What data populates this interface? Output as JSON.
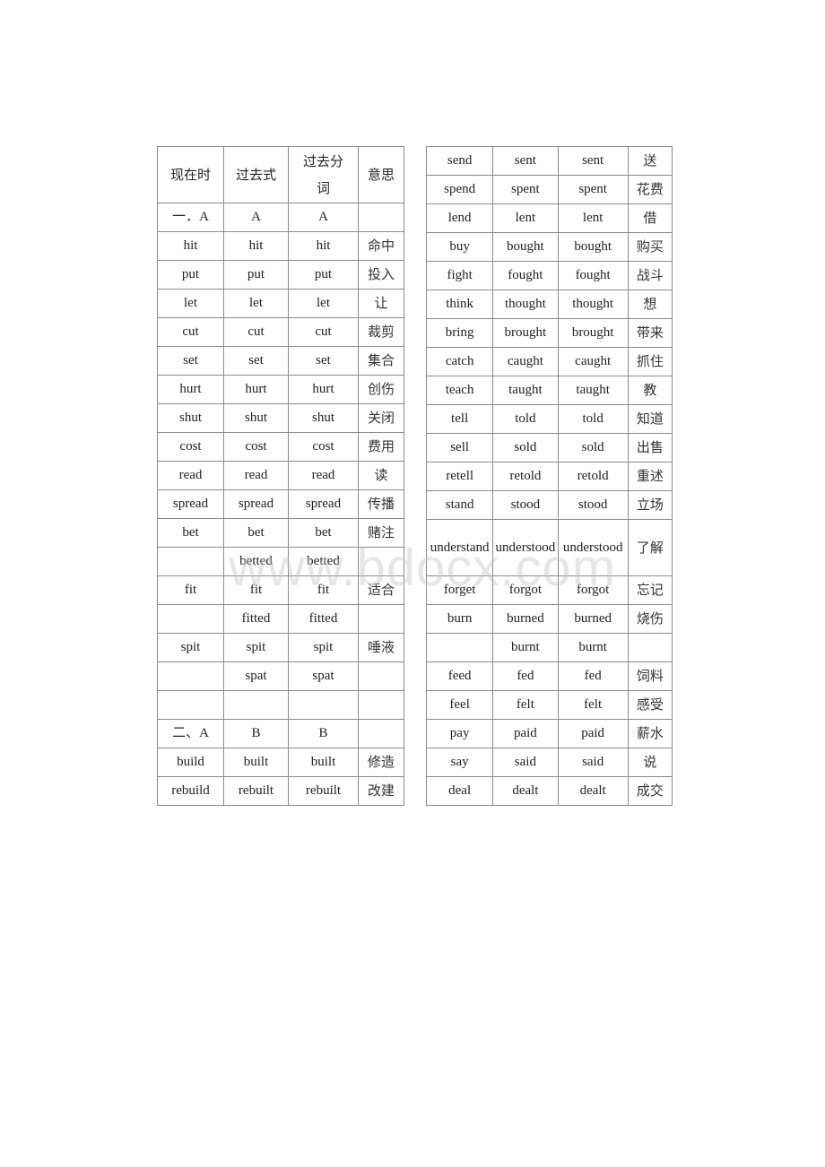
{
  "left_table": {
    "header": [
      "现在时",
      "过去式",
      "过去分词",
      "意思"
    ],
    "rows": [
      [
        "一．A",
        "A",
        "A",
        ""
      ],
      [
        "hit",
        "hit",
        "hit",
        "命中"
      ],
      [
        "put",
        "put",
        "put",
        "投入"
      ],
      [
        "let",
        "let",
        "let",
        "让"
      ],
      [
        "cut",
        "cut",
        "cut",
        "裁剪"
      ],
      [
        "set",
        "set",
        "set",
        "集合"
      ],
      [
        "hurt",
        "hurt",
        "hurt",
        "创伤"
      ],
      [
        "shut",
        "shut",
        "shut",
        "关闭"
      ],
      [
        "cost",
        "cost",
        "cost",
        "费用"
      ],
      [
        "read",
        "read",
        "read",
        "读"
      ],
      [
        "spread",
        "spread",
        "spread",
        "传播"
      ],
      [
        "bet",
        "bet",
        "bet",
        "赌注"
      ],
      [
        "",
        "betted",
        "betted",
        ""
      ],
      [
        "fit",
        "fit",
        "fit",
        "适合"
      ],
      [
        "",
        "fitted",
        "fitted",
        ""
      ],
      [
        "spit",
        "spit",
        "spit",
        "唾液"
      ],
      [
        "",
        "spat",
        "spat",
        ""
      ],
      [
        "",
        "",
        "",
        ""
      ],
      [
        "二、A",
        "B",
        "B",
        ""
      ],
      [
        "build",
        "built",
        "built",
        "修造"
      ],
      [
        "rebuild",
        "rebuilt",
        "rebuilt",
        "改建"
      ]
    ]
  },
  "right_table": {
    "rows": [
      [
        "send",
        "sent",
        "sent",
        "送"
      ],
      [
        "spend",
        "spent",
        "spent",
        "花费"
      ],
      [
        "lend",
        "lent",
        "lent",
        "借"
      ],
      [
        "buy",
        "bought",
        "bought",
        "购买"
      ],
      [
        "fight",
        "fought",
        "fought",
        "战斗"
      ],
      [
        "think",
        "thought",
        "thought",
        "想"
      ],
      [
        "bring",
        "brought",
        "brought",
        "带来"
      ],
      [
        "catch",
        "caught",
        "caught",
        "抓住"
      ],
      [
        "teach",
        "taught",
        "taught",
        "教"
      ],
      [
        "tell",
        "told",
        "told",
        "知道"
      ],
      [
        "sell",
        "sold",
        "sold",
        "出售"
      ],
      [
        "retell",
        "retold",
        "retold",
        "重述"
      ],
      [
        "stand",
        "stood",
        "stood",
        "立场"
      ],
      [
        "understand",
        "understood",
        "understood",
        "了解"
      ],
      [
        "forget",
        "forgot",
        "forgot",
        "忘记"
      ],
      [
        "burn",
        "burned",
        "burned",
        "烧伤"
      ],
      [
        "",
        "burnt",
        "burnt",
        ""
      ],
      [
        "feed",
        "fed",
        "fed",
        "饲料"
      ],
      [
        "feel",
        "felt",
        "felt",
        "感受"
      ],
      [
        "pay",
        "paid",
        "paid",
        "薪水"
      ],
      [
        "say",
        "said",
        "said",
        "说"
      ],
      [
        "deal",
        "dealt",
        "dealt",
        "成交"
      ]
    ]
  },
  "watermark": "www.bdocx.com"
}
